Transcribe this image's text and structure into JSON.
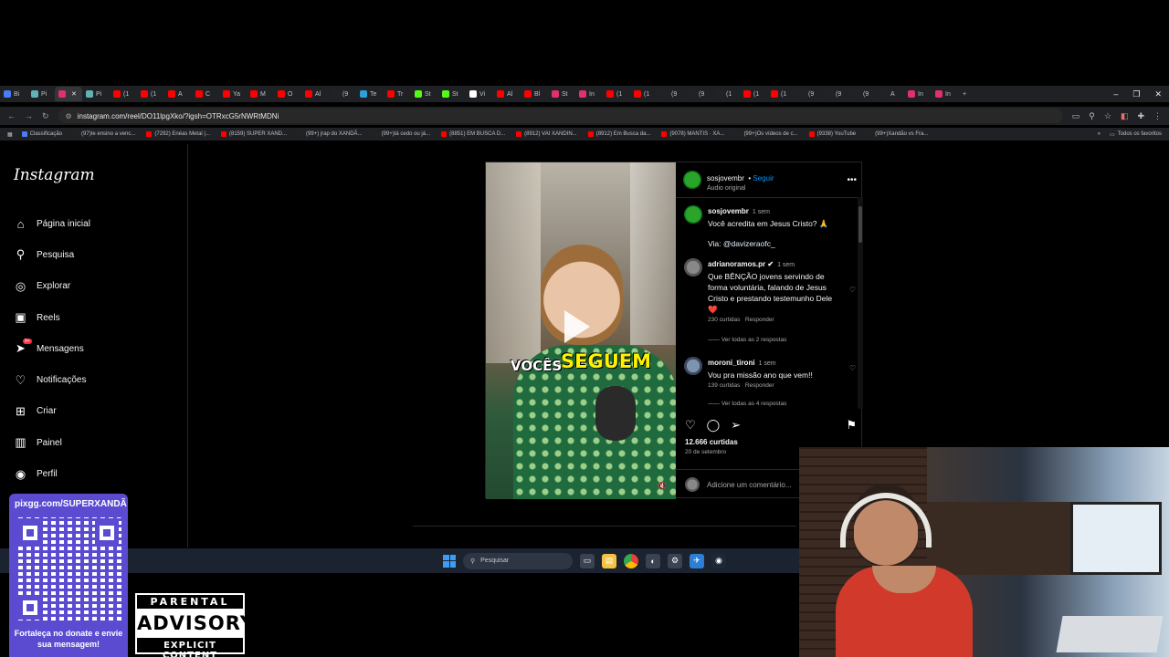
{
  "browser": {
    "tabs": [
      {
        "label": "Bi",
        "color": "#4a7cf7"
      },
      {
        "label": "Pi",
        "color": "#5fb3b3"
      },
      {
        "label": "",
        "color": "#e1306c",
        "active": true
      },
      {
        "label": "Pi",
        "color": "#5fb3b3"
      },
      {
        "label": "(1",
        "color": "#ff0000"
      },
      {
        "label": "(1",
        "color": "#ff0000"
      },
      {
        "label": "A",
        "color": "#ff0000"
      },
      {
        "label": "C",
        "color": "#ff0000"
      },
      {
        "label": "Ya",
        "color": "#ff0000"
      },
      {
        "label": "M",
        "color": "#ff0000"
      },
      {
        "label": "O",
        "color": "#ff0000"
      },
      {
        "label": "Al",
        "color": "#ff0000"
      },
      {
        "label": "(9",
        "color": "#222222"
      },
      {
        "label": "Te",
        "color": "#2aa1da"
      },
      {
        "label": "Tr",
        "color": "#ff0000"
      },
      {
        "label": "St",
        "color": "#53fc18"
      },
      {
        "label": "St",
        "color": "#53fc18"
      },
      {
        "label": "Vi",
        "color": "#ffffff"
      },
      {
        "label": "Al",
        "color": "#ff0000"
      },
      {
        "label": "Bl",
        "color": "#ff0000"
      },
      {
        "label": "St",
        "color": "#e1306c"
      },
      {
        "label": "In",
        "color": "#e1306c"
      },
      {
        "label": "(1",
        "color": "#ff0000"
      },
      {
        "label": "(1",
        "color": "#ff0000"
      },
      {
        "label": "(9",
        "color": "#222222"
      },
      {
        "label": "(9",
        "color": "#222222"
      },
      {
        "label": "(1",
        "color": "#222222"
      },
      {
        "label": "(1",
        "color": "#ff0000"
      },
      {
        "label": "(1",
        "color": "#ff0000"
      },
      {
        "label": "(9",
        "color": "#222222"
      },
      {
        "label": "(9",
        "color": "#222222"
      },
      {
        "label": "(9",
        "color": "#222222"
      },
      {
        "label": "A",
        "color": "#222222"
      },
      {
        "label": "In",
        "color": "#e1306c"
      },
      {
        "label": "In",
        "color": "#e1306c"
      }
    ],
    "new_tab": "+",
    "window_controls": {
      "minimize": "–",
      "maximize": "❐",
      "close": "✕"
    },
    "url": "instagram.com/reel/DO11lpgXko/?igsh=OTRxcG5rNWRtMDNi",
    "bookmarks": [
      {
        "label": "Classificação",
        "color": "#4a7cf7"
      },
      {
        "label": "(97)Ie ensino a venc...",
        "color": "#222222"
      },
      {
        "label": "(7292) Enéas Metal |...",
        "color": "#ff0000"
      },
      {
        "label": "(8159) SUPER XAND...",
        "color": "#ff0000"
      },
      {
        "label": "(99+) jrap do XANDÃ...",
        "color": "#222222"
      },
      {
        "label": "(99+)tá cedo ou já...",
        "color": "#222222"
      },
      {
        "label": "(8851) EM BUSCA D...",
        "color": "#ff0000"
      },
      {
        "label": "(8912) VAI XANDIN...",
        "color": "#ff0000"
      },
      {
        "label": "(8912) Em Busca da...",
        "color": "#ff0000"
      },
      {
        "label": "(9078) MANTIS · XA...",
        "color": "#ff0000"
      },
      {
        "label": "(99+)Os vídeos de c...",
        "color": "#222222"
      },
      {
        "label": "(9338) YouTube",
        "color": "#ff0000"
      },
      {
        "label": "(99+)Xandão vs Fra...",
        "color": "#222222"
      }
    ],
    "bookmarks_more": "»",
    "all_favorites": "Todos os favoritos"
  },
  "instagram": {
    "logo": "Instagram",
    "nav": [
      {
        "label": "Página inicial",
        "icon": "home-icon",
        "glyph": "⌂"
      },
      {
        "label": "Pesquisa",
        "icon": "search-icon",
        "glyph": "⚲"
      },
      {
        "label": "Explorar",
        "icon": "compass-icon",
        "glyph": "◎"
      },
      {
        "label": "Reels",
        "icon": "reels-icon",
        "glyph": "▣"
      },
      {
        "label": "Mensagens",
        "icon": "messages-icon",
        "glyph": "➤",
        "badge": "9+"
      },
      {
        "label": "Notificações",
        "icon": "heart-icon",
        "glyph": "♡"
      },
      {
        "label": "Criar",
        "icon": "create-icon",
        "glyph": "⊞"
      },
      {
        "label": "Painel",
        "icon": "dashboard-icon",
        "glyph": "▥"
      },
      {
        "label": "Perfil",
        "icon": "profile-icon",
        "glyph": "◉"
      }
    ],
    "post": {
      "video_caption_1": "VOCÊS",
      "video_caption_2": "SEGUEM",
      "author": "sosjovembr",
      "follow": "Seguir",
      "audio": "Áudio original",
      "caption_user": "sosjovembr",
      "caption_time": "1 sem",
      "caption_text": "Você acredita em Jesus Cristo? 🙏",
      "caption_via": "Via: ",
      "caption_via_link": "@davizeraofc_",
      "comments": [
        {
          "user": "adrianoramos.pr ✔",
          "time": "1 sem",
          "text": "Que BÊNÇÃO jovens servindo de forma voluntária, falando de Jesus Cristo e prestando testemunho Dele ❤️",
          "likes": "230 curtidas",
          "reply": "Responder",
          "replies": "Ver todas as 2 respostas"
        },
        {
          "user": "moroni_tironi",
          "time": "1 sem",
          "text": "Vou pra missão ano que vem!!",
          "likes": "139 curtidas",
          "reply": "Responder",
          "replies": "Ver todas as 4 respostas"
        }
      ],
      "likes": "12.666 curtidas",
      "date": "20 de setembro",
      "add_comment": "Adicione um comentário..."
    }
  },
  "taskbar": {
    "search_placeholder": "Pesquisar"
  },
  "overlay": {
    "qr_url": "pixgg.com/SUPERXANDÃ",
    "qr_message": "Fortaleça no donate e envie sua mensagem!",
    "advisory_top": "PARENTAL",
    "advisory_mid": "ADVISORY",
    "advisory_bot": "EXPLICIT CONTENT"
  }
}
